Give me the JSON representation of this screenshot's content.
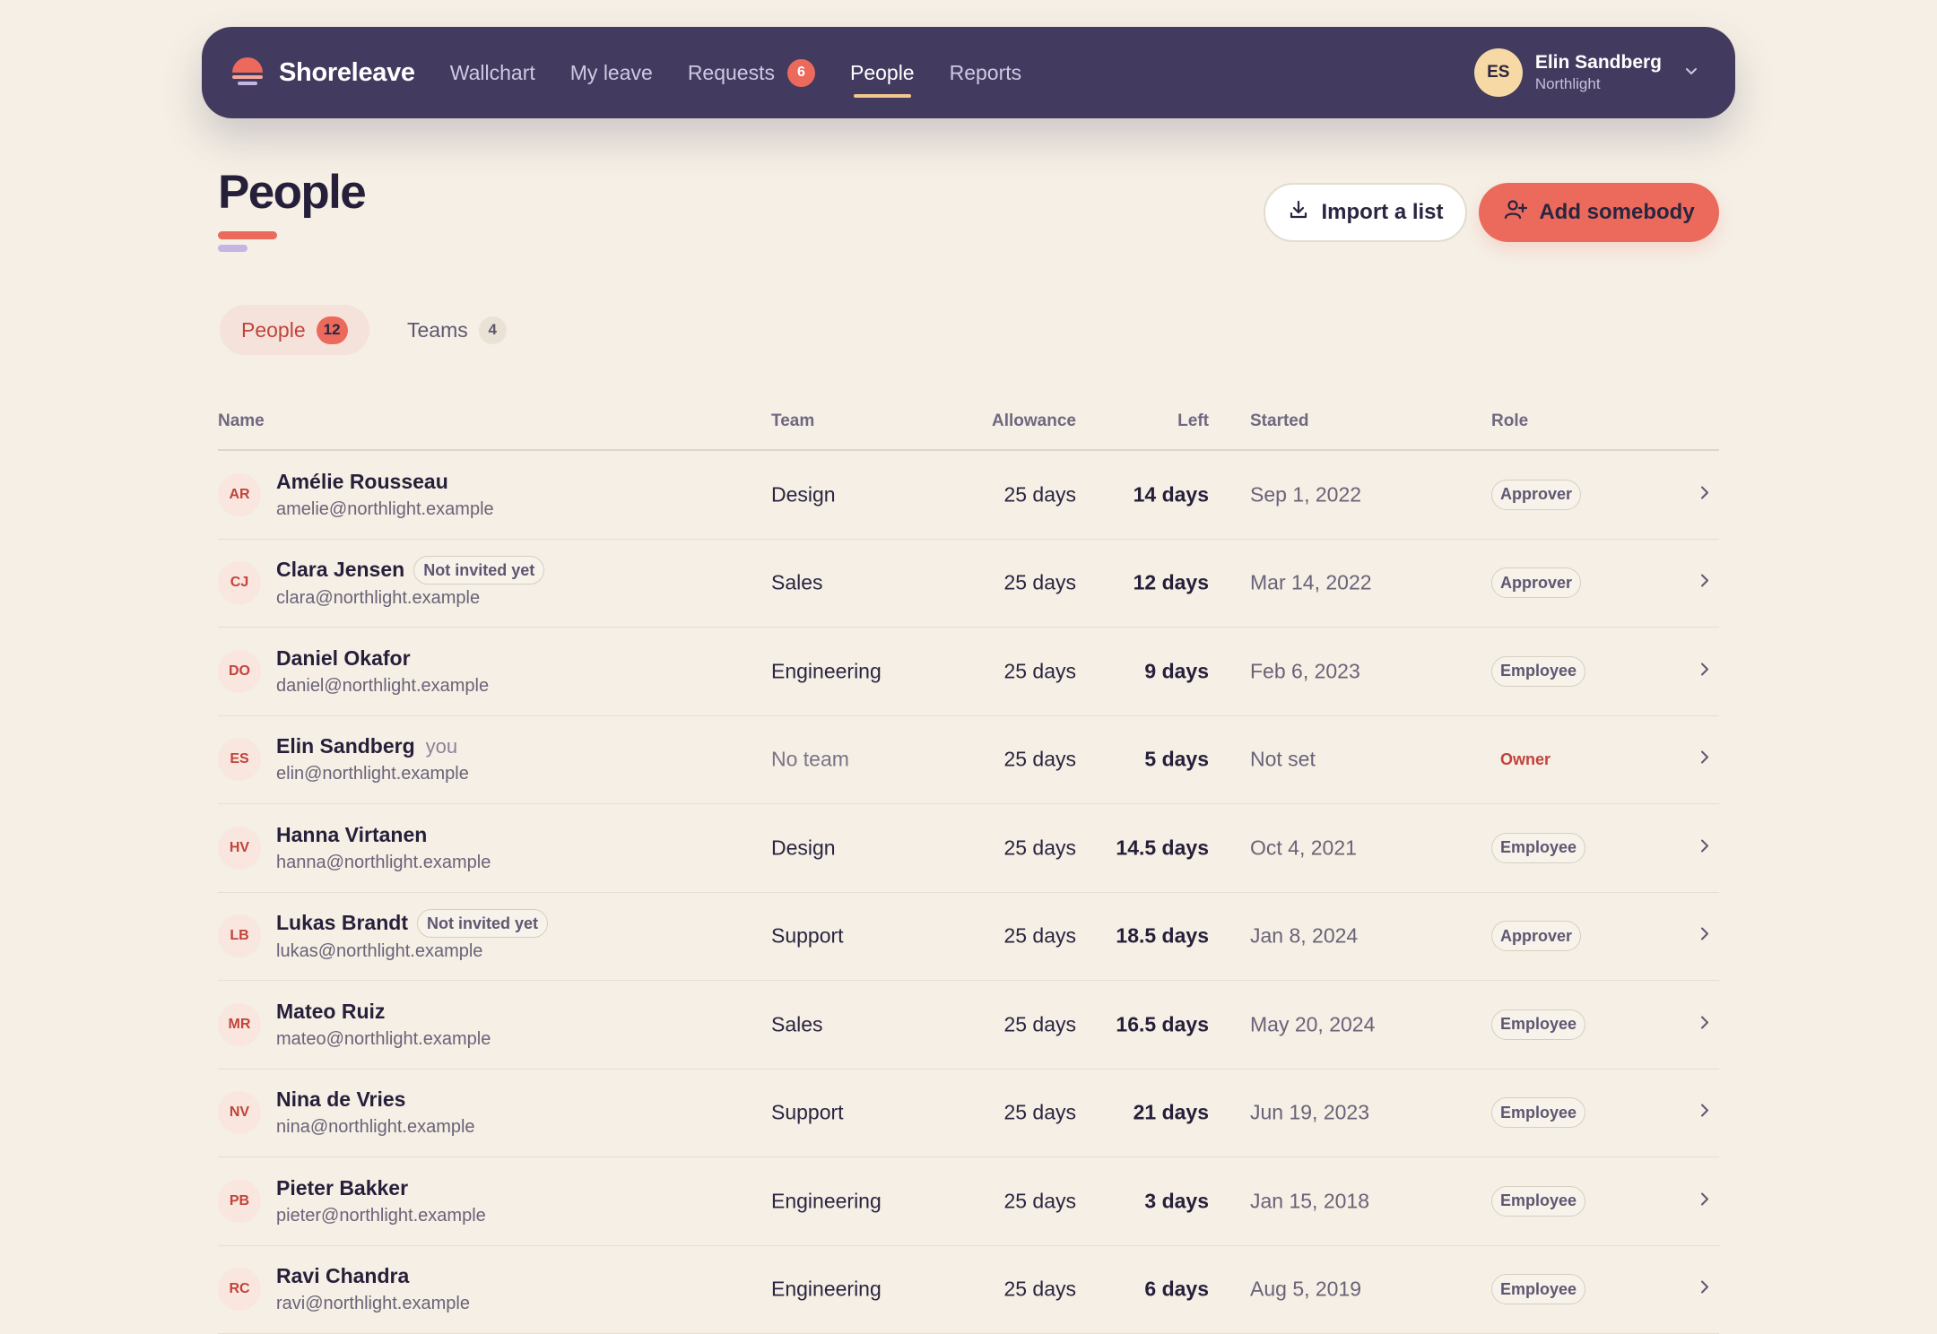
{
  "nav": {
    "brand": "Shoreleave",
    "items": [
      {
        "label": "Wallchart"
      },
      {
        "label": "My leave"
      },
      {
        "label": "Requests",
        "badge": "6"
      },
      {
        "label": "People",
        "active": true
      },
      {
        "label": "Reports"
      }
    ],
    "user": {
      "initials": "ES",
      "name": "Elin Sandberg",
      "org": "Northlight"
    }
  },
  "page": {
    "title": "People",
    "import_label": "Import a list",
    "add_label": "Add somebody"
  },
  "tabs": [
    {
      "label": "People",
      "count": "12",
      "active": true
    },
    {
      "label": "Teams",
      "count": "4"
    }
  ],
  "table": {
    "headers": {
      "name": "Name",
      "team": "Team",
      "allowance": "Allowance",
      "left": "Left",
      "started": "Started",
      "role": "Role"
    },
    "rows": [
      {
        "initials": "AR",
        "name": "Amélie Rousseau",
        "email": "amelie@northlight.example",
        "tag": "",
        "team": "Design",
        "allowance": "25 days",
        "left": "14 days",
        "started": "Sep 1, 2022",
        "role": "Approver"
      },
      {
        "initials": "CJ",
        "name": "Clara Jensen",
        "email": "clara@northlight.example",
        "tag": "Not invited yet",
        "team": "Sales",
        "allowance": "25 days",
        "left": "12 days",
        "started": "Mar 14, 2022",
        "role": "Approver"
      },
      {
        "initials": "DO",
        "name": "Daniel Okafor",
        "email": "daniel@northlight.example",
        "tag": "",
        "team": "Engineering",
        "allowance": "25 days",
        "left": "9 days",
        "started": "Feb 6, 2023",
        "role": "Employee"
      },
      {
        "initials": "ES",
        "name": "Elin Sandberg",
        "email": "elin@northlight.example",
        "tag": "",
        "you": "you",
        "team": "No team",
        "allowance": "25 days",
        "left": "5 days",
        "started": "Not set",
        "role": "Owner"
      },
      {
        "initials": "HV",
        "name": "Hanna Virtanen",
        "email": "hanna@northlight.example",
        "tag": "",
        "team": "Design",
        "allowance": "25 days",
        "left": "14.5 days",
        "started": "Oct 4, 2021",
        "role": "Employee"
      },
      {
        "initials": "LB",
        "name": "Lukas Brandt",
        "email": "lukas@northlight.example",
        "tag": "Not invited yet",
        "team": "Support",
        "allowance": "25 days",
        "left": "18.5 days",
        "started": "Jan 8, 2024",
        "role": "Approver"
      },
      {
        "initials": "MR",
        "name": "Mateo Ruiz",
        "email": "mateo@northlight.example",
        "tag": "",
        "team": "Sales",
        "allowance": "25 days",
        "left": "16.5 days",
        "started": "May 20, 2024",
        "role": "Employee"
      },
      {
        "initials": "NV",
        "name": "Nina de Vries",
        "email": "nina@northlight.example",
        "tag": "",
        "team": "Support",
        "allowance": "25 days",
        "left": "21 days",
        "started": "Jun 19, 2023",
        "role": "Employee"
      },
      {
        "initials": "PB",
        "name": "Pieter Bakker",
        "email": "pieter@northlight.example",
        "tag": "",
        "team": "Engineering",
        "allowance": "25 days",
        "left": "3 days",
        "started": "Jan 15, 2018",
        "role": "Employee"
      },
      {
        "initials": "RC",
        "name": "Ravi Chandra",
        "email": "ravi@northlight.example",
        "tag": "",
        "team": "Engineering",
        "allowance": "25 days",
        "left": "6 days",
        "started": "Aug 5, 2019",
        "role": "Employee"
      }
    ]
  },
  "colors": {
    "nav_bg": "#433a5f",
    "accent": "#ec6a5c",
    "page_bg": "#f5efe5",
    "underline": "#f4c78c"
  }
}
